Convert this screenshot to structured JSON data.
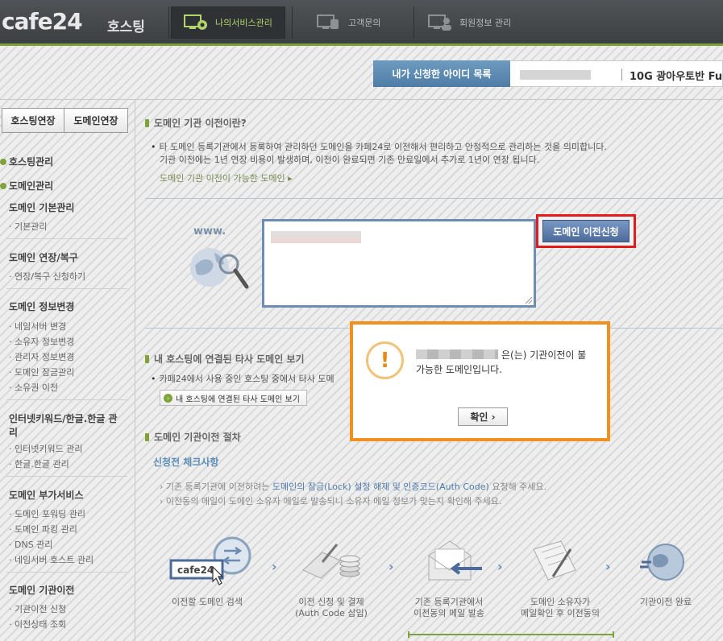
{
  "header": {
    "logo": "cafe24",
    "logo_sub": "호스팅",
    "nav": [
      {
        "label": "나의서비스관리",
        "icon": "settings-monitor-icon",
        "active": true
      },
      {
        "label": "고객문의",
        "icon": "phone-monitor-icon",
        "active": false
      },
      {
        "label": "회원정보 관리",
        "icon": "user-monitor-icon",
        "active": false
      }
    ]
  },
  "id_bar": {
    "label": "내가 신청한 아이디 목록",
    "product": "10G 광아우토반 Fu"
  },
  "sidebar": {
    "tabs": [
      "호스팅연장",
      "도메인연장"
    ],
    "sections": [
      "호스팅관리",
      "도메인관리"
    ],
    "groups": [
      {
        "title": "도메인 기본관리",
        "links": [
          "기본관리"
        ]
      },
      {
        "title": "도메인 연장/복구",
        "links": [
          "연장/복구 신청하기"
        ]
      },
      {
        "title": "도메인 정보변경",
        "links": [
          "네임서버 변경",
          "소유자 정보변경",
          "관리자 정보변경",
          "도메인 잠금관리",
          "소유권 이전"
        ]
      },
      {
        "title": "인터넷키워드/한글.한글 관리",
        "links": [
          "인터넷키워드 관리",
          "한글.한글 관리"
        ]
      },
      {
        "title": "도메인 부가서비스",
        "links": [
          "도메인 포워딩 관리",
          "도메인 파킹 관리",
          "DNS 관리",
          "네임서버 호스트 관리"
        ]
      },
      {
        "title": "도메인 기관이전",
        "links": [
          "기관이전 신청",
          "이전상태 조회"
        ]
      }
    ]
  },
  "main": {
    "intro_title": "도메인 기관 이전이란?",
    "intro_line1": "타 도메인 등록기관에서 등록하여 관리하던 도메인을 카페24로 이전해서 편리하고 안정적으로 관리하는 것을 의미합니다.",
    "intro_line2": "기관 이전에는 1년 연장 비용이 발생하며, 이전이 완료되면 기존 만료일에서 추가로 1년이 연장 됩니다.",
    "intro_link": "도메인 기관 이전이 가능한 도메인 ▸",
    "www": "www.",
    "apply_button": "도메인 이전신청",
    "linked_title": "내 호스팅에 연결된 타사 도메인 보기",
    "linked_desc": "카페24에서 사용 중인 호스팅 중에서 타사 도메",
    "linked_button": "내 호스팅에 연결된 타사 도메인 보기",
    "proc_title": "도메인 기관이전 절차",
    "check_title": "신청전 체크사항",
    "check_line1": {
      "pre": "기존 등록기관에 이전하려는 ",
      "hl": "도메인의 잠금(Lock) 설정 해제 및 인증코드(Auth Code)",
      "post": " 요청해 주세요."
    },
    "check_line2": "이전동의 메일이 도메인 소유자 메일로 발송되니 소유자 메일 정보가 맞는지 확인해 주세요.",
    "steps": [
      {
        "line1": "이전할 도메인 검색",
        "line2": "",
        "icon": "domain-search-icon"
      },
      {
        "line1": "이전 신청 및 결제",
        "line2": "(Auth Code 삽입)",
        "icon": "payment-coins-icon"
      },
      {
        "line1": "기존 등록기관에서",
        "line2": "이전동의 메일 발송",
        "icon": "mail-send-icon"
      },
      {
        "line1": "도메인 소유자가",
        "line2": "메일확인 후 이전동의",
        "icon": "document-check-icon"
      },
      {
        "line1": "기관이전 완료",
        "line2": "",
        "icon": "globe-complete-icon"
      }
    ]
  },
  "modal": {
    "msg1": "은(는) 기관이전이 불",
    "msg2": "가능한 도메인입니다.",
    "ok": "확인 ›"
  },
  "colors": {
    "accent_green": "#7fa33a",
    "modal_border": "#f0901e",
    "highlight_red": "#e21b1b",
    "button_blue": "#4c6b9a"
  }
}
